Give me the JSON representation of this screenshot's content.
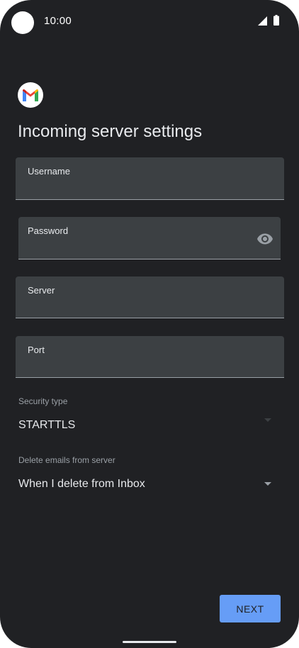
{
  "status_bar": {
    "time": "10:00",
    "icons": [
      "signal-icon",
      "battery-icon"
    ]
  },
  "header": {
    "logo_icon": "gmail-logo",
    "title": "Incoming server settings"
  },
  "form": {
    "username": {
      "label": "Username",
      "value": ""
    },
    "password": {
      "label": "Password",
      "value": "",
      "icon": "eye-icon"
    },
    "server": {
      "label": "Server",
      "value": ""
    },
    "port": {
      "label": "Port",
      "value": ""
    },
    "security_type": {
      "label": "Security type",
      "value": "STARTTLS"
    },
    "delete_emails": {
      "label": "Delete emails from server",
      "value": "When I delete from Inbox"
    }
  },
  "actions": {
    "next_label": "NEXT"
  },
  "colors": {
    "background": "#202124",
    "field_background": "#3c4043",
    "accent": "#669df6",
    "text": "#e8eaed",
    "muted_text": "#9aa0a6"
  }
}
